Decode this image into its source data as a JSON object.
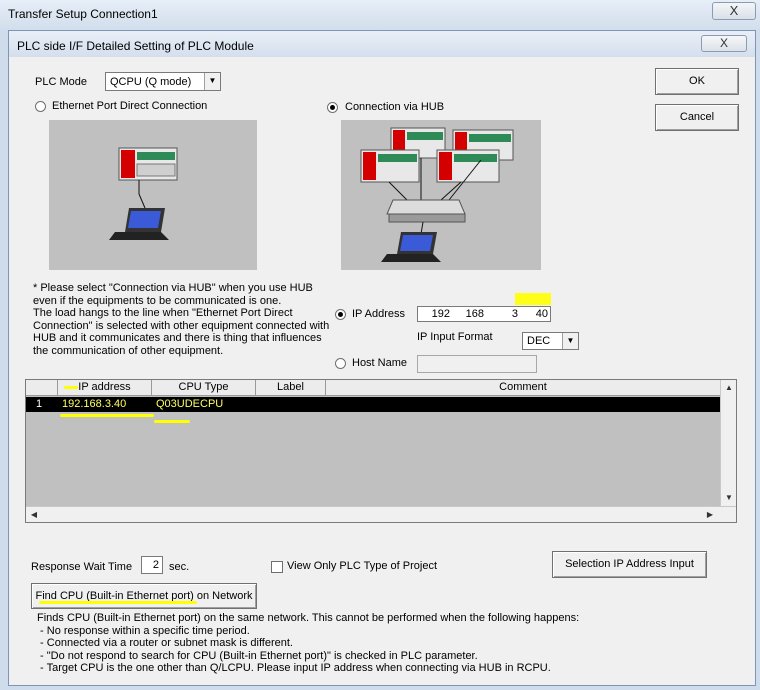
{
  "window": {
    "title": "Transfer Setup Connection1",
    "close_label": "X"
  },
  "dialog": {
    "title": "PLC side I/F Detailed Setting of PLC Module",
    "close_label": "X"
  },
  "plc_mode": {
    "label": "PLC Mode",
    "value": "QCPU (Q mode)"
  },
  "buttons": {
    "ok": "OK",
    "cancel": "Cancel",
    "selection_ip": "Selection IP Address Input",
    "find_cpu": "Find CPU (Built-in Ethernet port) on Network"
  },
  "connection": {
    "direct_label": "Ethernet Port Direct Connection",
    "hub_label": "Connection via HUB",
    "selected": "hub"
  },
  "note_lines": [
    "* Please select \"Connection via HUB\" when you use HUB",
    "even if the equipments to be communicated is one.",
    "The load hangs to the line when \"Ethernet Port Direct",
    "Connection\" is selected with other equipment connected with",
    "HUB and it communicates and there is thing that influences",
    "the communication of other equipment."
  ],
  "ip": {
    "label": "IP Address",
    "octets": [
      "192",
      "168",
      "3",
      "40"
    ],
    "format_label": "IP Input Format",
    "format_value": "DEC"
  },
  "host": {
    "label": "Host Name",
    "value": ""
  },
  "table": {
    "columns": [
      "IP address",
      "CPU Type",
      "Label",
      "Comment"
    ],
    "rows": [
      {
        "no": "1",
        "ip": "192.168.3.40",
        "cpu": "Q03UDECPU",
        "label": "",
        "comment": ""
      }
    ]
  },
  "response": {
    "label": "Response Wait Time",
    "value": "2",
    "unit": "sec."
  },
  "view_only": {
    "label": "View Only PLC Type of Project",
    "checked": false
  },
  "find_notes": [
    "Finds CPU (Built-in Ethernet port) on the same network. This cannot be performed when the following happens:",
    " - No response within a specific time period.",
    " - Connected via a router or subnet mask is different.",
    " - \"Do not respond to search for CPU (Built-in Ethernet port)\" is checked in PLC parameter.",
    " - Target CPU is the one other than Q/LCPU. Please input IP address when connecting via HUB in RCPU."
  ],
  "icons": {
    "dropdown": "chevron-down-icon",
    "up": "arrow-up-icon",
    "down": "arrow-down-icon",
    "left": "arrow-left-icon",
    "right": "arrow-right-icon"
  },
  "colors": {
    "highlight": "#ffff00",
    "selected_row_bg": "#000000",
    "selected_row_text": "#ffff66"
  }
}
